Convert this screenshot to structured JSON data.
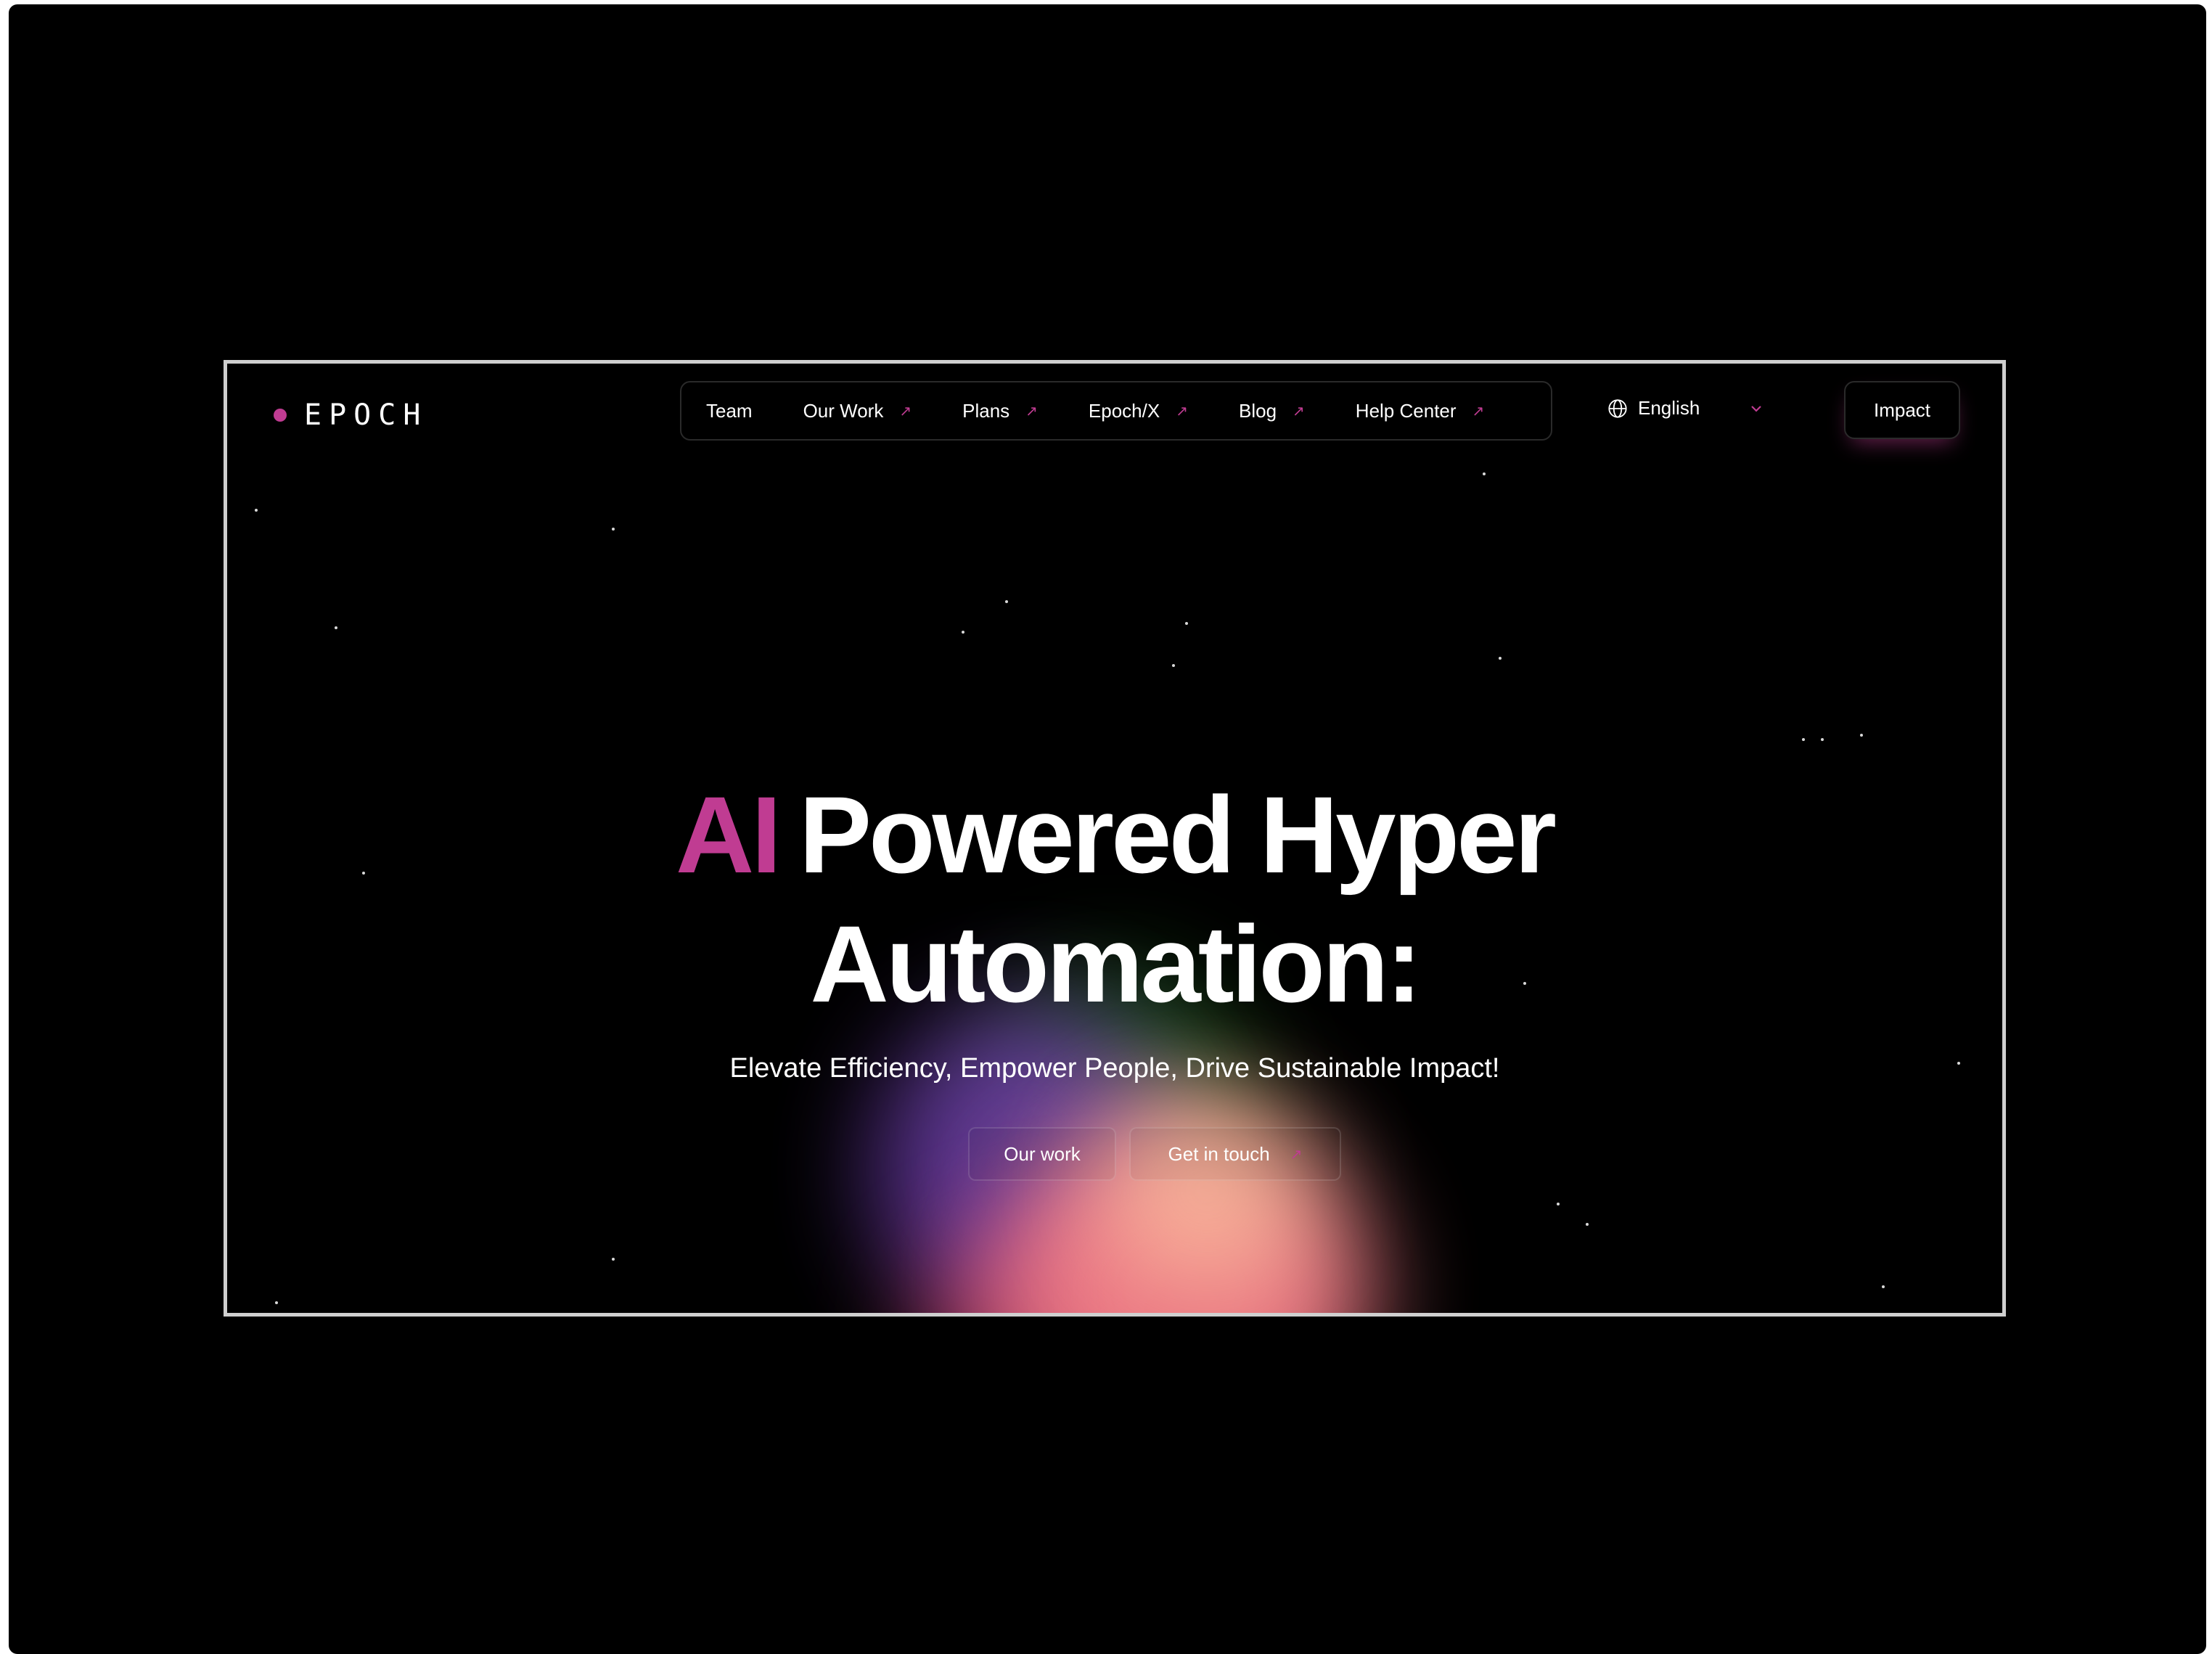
{
  "brand": {
    "name": "EPOCH",
    "accent_color": "#c03c92"
  },
  "nav": {
    "items": [
      {
        "label": "Team",
        "external": false
      },
      {
        "label": "Our Work",
        "external": true
      },
      {
        "label": "Plans",
        "external": true
      },
      {
        "label": "Epoch/X",
        "external": true
      },
      {
        "label": "Blog",
        "external": true
      },
      {
        "label": "Help Center",
        "external": true
      }
    ],
    "external_icon": "arrow-up-right-icon"
  },
  "language": {
    "selected": "English",
    "icon": "globe-icon",
    "dropdown_icon": "chevron-down-icon"
  },
  "header_button": {
    "label": "Impact"
  },
  "hero": {
    "headline_highlight": "AI",
    "headline_rest_line1": "Powered Hyper",
    "headline_line2": "Automation:",
    "subtitle": "Elevate Efficiency, Empower People, Drive Sustainable Impact!",
    "buttons": [
      {
        "label": "Our work"
      },
      {
        "label": "Get in touch"
      }
    ]
  },
  "colors": {
    "background": "#000000",
    "text": "#ffffff",
    "accent": "#c03c92",
    "frame_border": "#cfcfcf"
  }
}
